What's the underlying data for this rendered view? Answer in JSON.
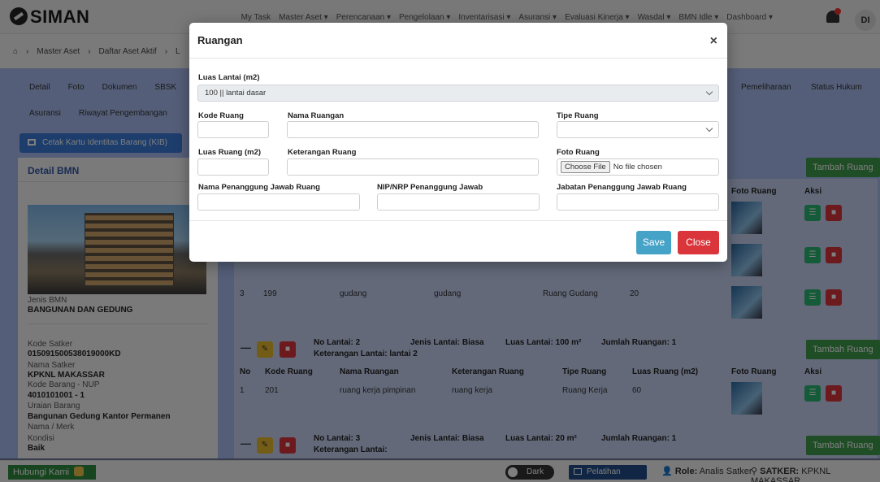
{
  "app": {
    "logo": "SIMAN"
  },
  "nav": {
    "items": [
      "My Task",
      "Master Aset ▾",
      "Perencanaan ▾",
      "Pengelolaan ▾",
      "Inventarisasi ▾",
      "Asuransi ▾",
      "Evaluasi Kinerja ▾",
      "Wasdal ▾",
      "BMN Idle ▾",
      "Dashboard ▾"
    ],
    "avatar": "DI"
  },
  "breadcrumb": {
    "home": "⌂",
    "items": [
      "Master Aset",
      "Daftar Aset Aktif",
      "L"
    ]
  },
  "tabs": {
    "row1": [
      "Detail",
      "Foto",
      "Dokumen",
      "SBSK"
    ],
    "row1_right": [
      "Pemeliharaan",
      "Status Hukum"
    ],
    "row2": [
      "Asuransi",
      "Riwayat Pengembangan"
    ]
  },
  "kib_button": "Cetak Kartu Identitas Barang (KIB)",
  "detail": {
    "title": "Detail BMN",
    "jenis_label": "Jenis BMN",
    "jenis_value": "BANGUNAN DAN GEDUNG",
    "kode_satker_label": "Kode Satker",
    "kode_satker_value": "015091500538019000KD",
    "nama_satker_label": "Nama Satker",
    "nama_satker_value": "KPKNL MAKASSAR",
    "kode_barang_label": "Kode Barang - NUP",
    "kode_barang_value": "4010101001 - 1",
    "uraian_label": "Uraian Barang",
    "uraian_value": "Bangunan Gedung Kantor Permanen",
    "merk_label": "Nama / Merk",
    "kondisi_label": "Kondisi",
    "kondisi_value": "Baik"
  },
  "rooms": {
    "add_label": "Tambah Ruang",
    "header_foto": "Foto Ruang",
    "header_aksi": "Aksi",
    "row3": {
      "no": "3",
      "kode": "199",
      "nama": "gudang",
      "keterangan": "gudang",
      "tipe": "Ruang Gudang",
      "luas": "20"
    },
    "floor2": {
      "no_lantai": "No Lantai: 2",
      "jenis": "Jenis Lantai: Biasa",
      "luas": "Luas Lantai: 100 m²",
      "jumlah": "Jumlah Ruangan: 1",
      "keterangan": "Keterangan Lantai: lantai 2"
    },
    "headers": [
      "No",
      "Kode Ruang",
      "Nama Ruangan",
      "Keterangan Ruang",
      "Tipe Ruang",
      "Luas Ruang (m2)",
      "Foto Ruang",
      "Aksi"
    ],
    "floor2_row": {
      "no": "1",
      "kode": "201",
      "nama": "ruang kerja pimpinan",
      "keterangan": "ruang kerja",
      "tipe": "Ruang Kerja",
      "luas": "60"
    },
    "floor3": {
      "no_lantai": "No Lantai: 3",
      "jenis": "Jenis Lantai: Biasa",
      "luas": "Luas Lantai: 20 m²",
      "jumlah": "Jumlah Ruangan: 1",
      "keterangan": "Keterangan Lantai:"
    }
  },
  "modal": {
    "title": "Ruangan",
    "close_icon": "×",
    "luas_lantai_label": "Luas Lantai (m2)",
    "luas_lantai_value": "100 || lantai dasar",
    "kode_ruang_label": "Kode Ruang",
    "nama_ruangan_label": "Nama Ruangan",
    "tipe_ruang_label": "Tipe Ruang",
    "luas_ruang_label": "Luas Ruang (m2)",
    "keterangan_label": "Keterangan Ruang",
    "foto_label": "Foto Ruang",
    "file_button": "Choose File",
    "file_status": "No file chosen",
    "pj_nama_label": "Nama Penanggung Jawab Ruang",
    "pj_nip_label": "NIP/NRP Penanggung Jawab",
    "pj_jabatan_label": "Jabatan Penanggung Jawab Ruang",
    "save": "Save",
    "close": "Close"
  },
  "footer": {
    "contact": "Hubungi Kami",
    "dark": "Dark",
    "pelatihan": "Pelatihan",
    "role_label": "Role:",
    "role_value": "Analis Satker",
    "satker_label": "SATKER:",
    "satker_value": "KPKNL MAKASSAR"
  },
  "colors": {
    "primary": "#3b7bd9",
    "success": "#3e9a4b",
    "danger": "#d9353b",
    "info": "#45a3c7",
    "panel": "#a9bdf0"
  }
}
